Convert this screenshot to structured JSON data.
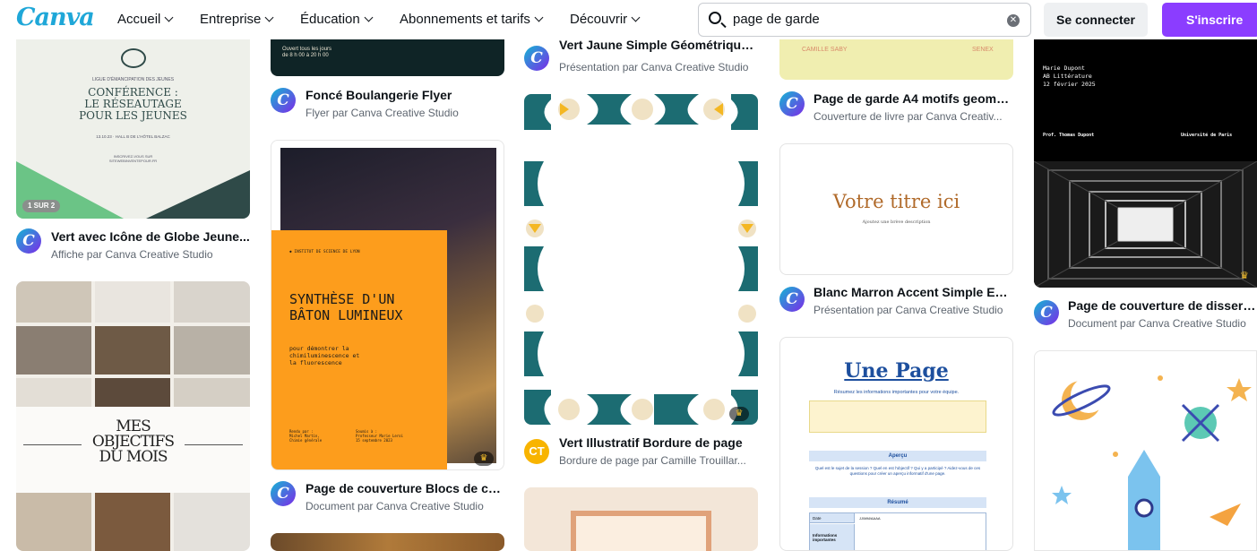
{
  "header": {
    "logo": "Canva",
    "nav": [
      "Accueil",
      "Entreprise",
      "Éducation",
      "Abonnements et tarifs",
      "Découvrir"
    ],
    "search_value": "page de garde",
    "login": "Se connecter",
    "signup": "S'inscrire"
  },
  "cards": {
    "c1": {
      "badge": "1 SUR 2",
      "title": "Vert avec Icône de Globe Jeune...",
      "subtitle": "Affiche par Canva Creative Studio",
      "art": {
        "line1": "LIGUE D'ÉMANCIPATION DES JEUNES",
        "h1": "CONFÉRENCE :",
        "h2": "LE RÉSEAUTAGE",
        "h3": "POUR LES JEUNES",
        "info": "13.10.23 · HALL B DE L'HÔTEL BALZAC",
        "foot1": "INSCRIVEZ-VOUS SUR",
        "foot2": "SITEWEBINVENTEPOUR.FR"
      }
    },
    "c2": {
      "art": {
        "line1": "MES",
        "line2": "OBJECTIFS",
        "line3": "DU MOIS"
      }
    },
    "c3": {
      "title": "Foncé Boulangerie Flyer",
      "subtitle": "Flyer par Canva Creative Studio",
      "art": {
        "l1": "Ouvert tous les jours",
        "l2": "de 8 h 00 à 20 h 00"
      }
    },
    "c4": {
      "title": "Page de couverture Blocs de co...",
      "subtitle": "Document par Canva Creative Studio",
      "art": {
        "inst": "INSTITUT DE SCIENCE DE LYON",
        "h1": "SYNTHÈSE D'UN",
        "h2": "BÂTON LUMINEUX",
        "d1": "pour démontrer la",
        "d2": "chimiluminescence et",
        "d3": "la fluorescence",
        "r1": "Rendu par :",
        "r2": "Michel Martin,",
        "r3": "Chimie générale",
        "s1": "Soumis à :",
        "s2": "Professeur Marie Leroi",
        "s3": "15 septembre 2023"
      }
    },
    "c5": {
      "title": "Vert Jaune Simple Géométrique...",
      "subtitle": "Présentation par Canva Creative Studio"
    },
    "c6": {
      "avatar": "CT",
      "title": "Vert Illustratif Bordure de page",
      "subtitle": "Bordure de page par Camille Trouillar..."
    },
    "c8": {
      "art": {
        "a": "CAMILLE SABY",
        "b": "SENEX"
      },
      "title": "Page de garde A4 motifs geomet...",
      "subtitle": "Couverture de livre par Canva Creativ..."
    },
    "c9": {
      "art": {
        "h": "Votre titre ici",
        "d": "Ajoutez une brève description"
      },
      "title": "Blanc Marron Accent Simple Ent...",
      "subtitle": "Présentation par Canva Creative Studio"
    },
    "c10": {
      "art": {
        "h": "Une Page",
        "sub": "Résumez les informations importantes pour votre équipe.",
        "apercu": "Aperçu",
        "q": "Quel est le sujet de la session ? Quel en est l'objectif ? Qui y a participé ? Aidez-vous de ces questions pour créer un aperçu informatif d'une page.",
        "resume": "Résumé",
        "date_k": "Date",
        "date_v": "JJ/MM/AAAA",
        "info_k": "Informations importantes"
      }
    },
    "c11": {
      "art": {
        "a1": "Marie Dupont",
        "a2": "AB Littérature",
        "a3": "12 février 2025",
        "prof": "Prof. Thomas Dupont",
        "univ": "Université de Paris"
      },
      "title": "Page de couverture de dissertat...",
      "subtitle": "Document par Canva Creative Studio"
    }
  }
}
